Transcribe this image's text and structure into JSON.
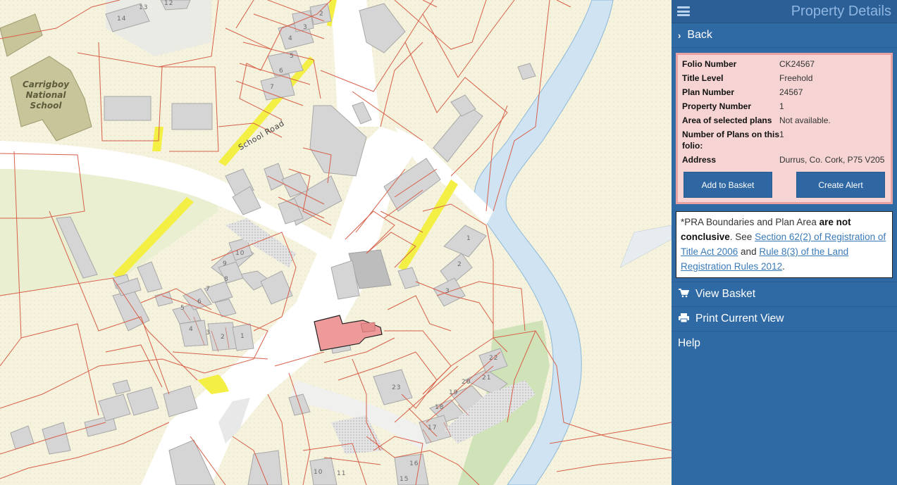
{
  "panel": {
    "title": "Property Details",
    "back_label": "Back",
    "details": {
      "folio_label": "Folio Number",
      "folio_value": "CK24567",
      "title_level_label": "Title Level",
      "title_level_value": "Freehold",
      "plan_number_label": "Plan Number",
      "plan_number_value": "24567",
      "property_number_label": "Property Number",
      "property_number_value": "1",
      "area_label": "Area of selected plans",
      "area_value": "Not available.",
      "num_plans_label": "Number of Plans on this folio:",
      "num_plans_value": "1",
      "address_label": "Address",
      "address_value": "Durrus, Co. Cork, P75 V205"
    },
    "buttons": {
      "add_basket": "Add to Basket",
      "create_alert": "Create Alert"
    },
    "notice": {
      "prefix": "*PRA Boundaries and Plan Area ",
      "bold": "are not conclusive",
      "see": ". See ",
      "link1": "Section 62(2) of Registration of Title Act 2006",
      "and": " and ",
      "link2": "Rule 8(3) of the Land Registration Rules 2012",
      "end": "."
    },
    "menu": {
      "view_basket": "View Basket",
      "print_view": "Print Current View",
      "help": "Help"
    }
  },
  "map": {
    "school_label": "Carrigboy National School",
    "road_label": "School Road",
    "house_numbers": [
      "13",
      "12",
      "14",
      "2",
      "3",
      "4",
      "5",
      "6",
      "7",
      "10",
      "9",
      "8",
      "7",
      "6",
      "5",
      "4",
      "3",
      "2",
      "1",
      "1",
      "2",
      "3",
      "22",
      "21",
      "20",
      "19",
      "18",
      "17",
      "23",
      "16",
      "15",
      "10",
      "11"
    ]
  },
  "colors": {
    "panel_bg": "#2f6aa5",
    "details_bg": "#f6d4d4",
    "details_border": "#e9a2a2",
    "selected_parcel": "#ef9a9a",
    "river": "#cfe3f2",
    "boundary": "#d7604a"
  }
}
